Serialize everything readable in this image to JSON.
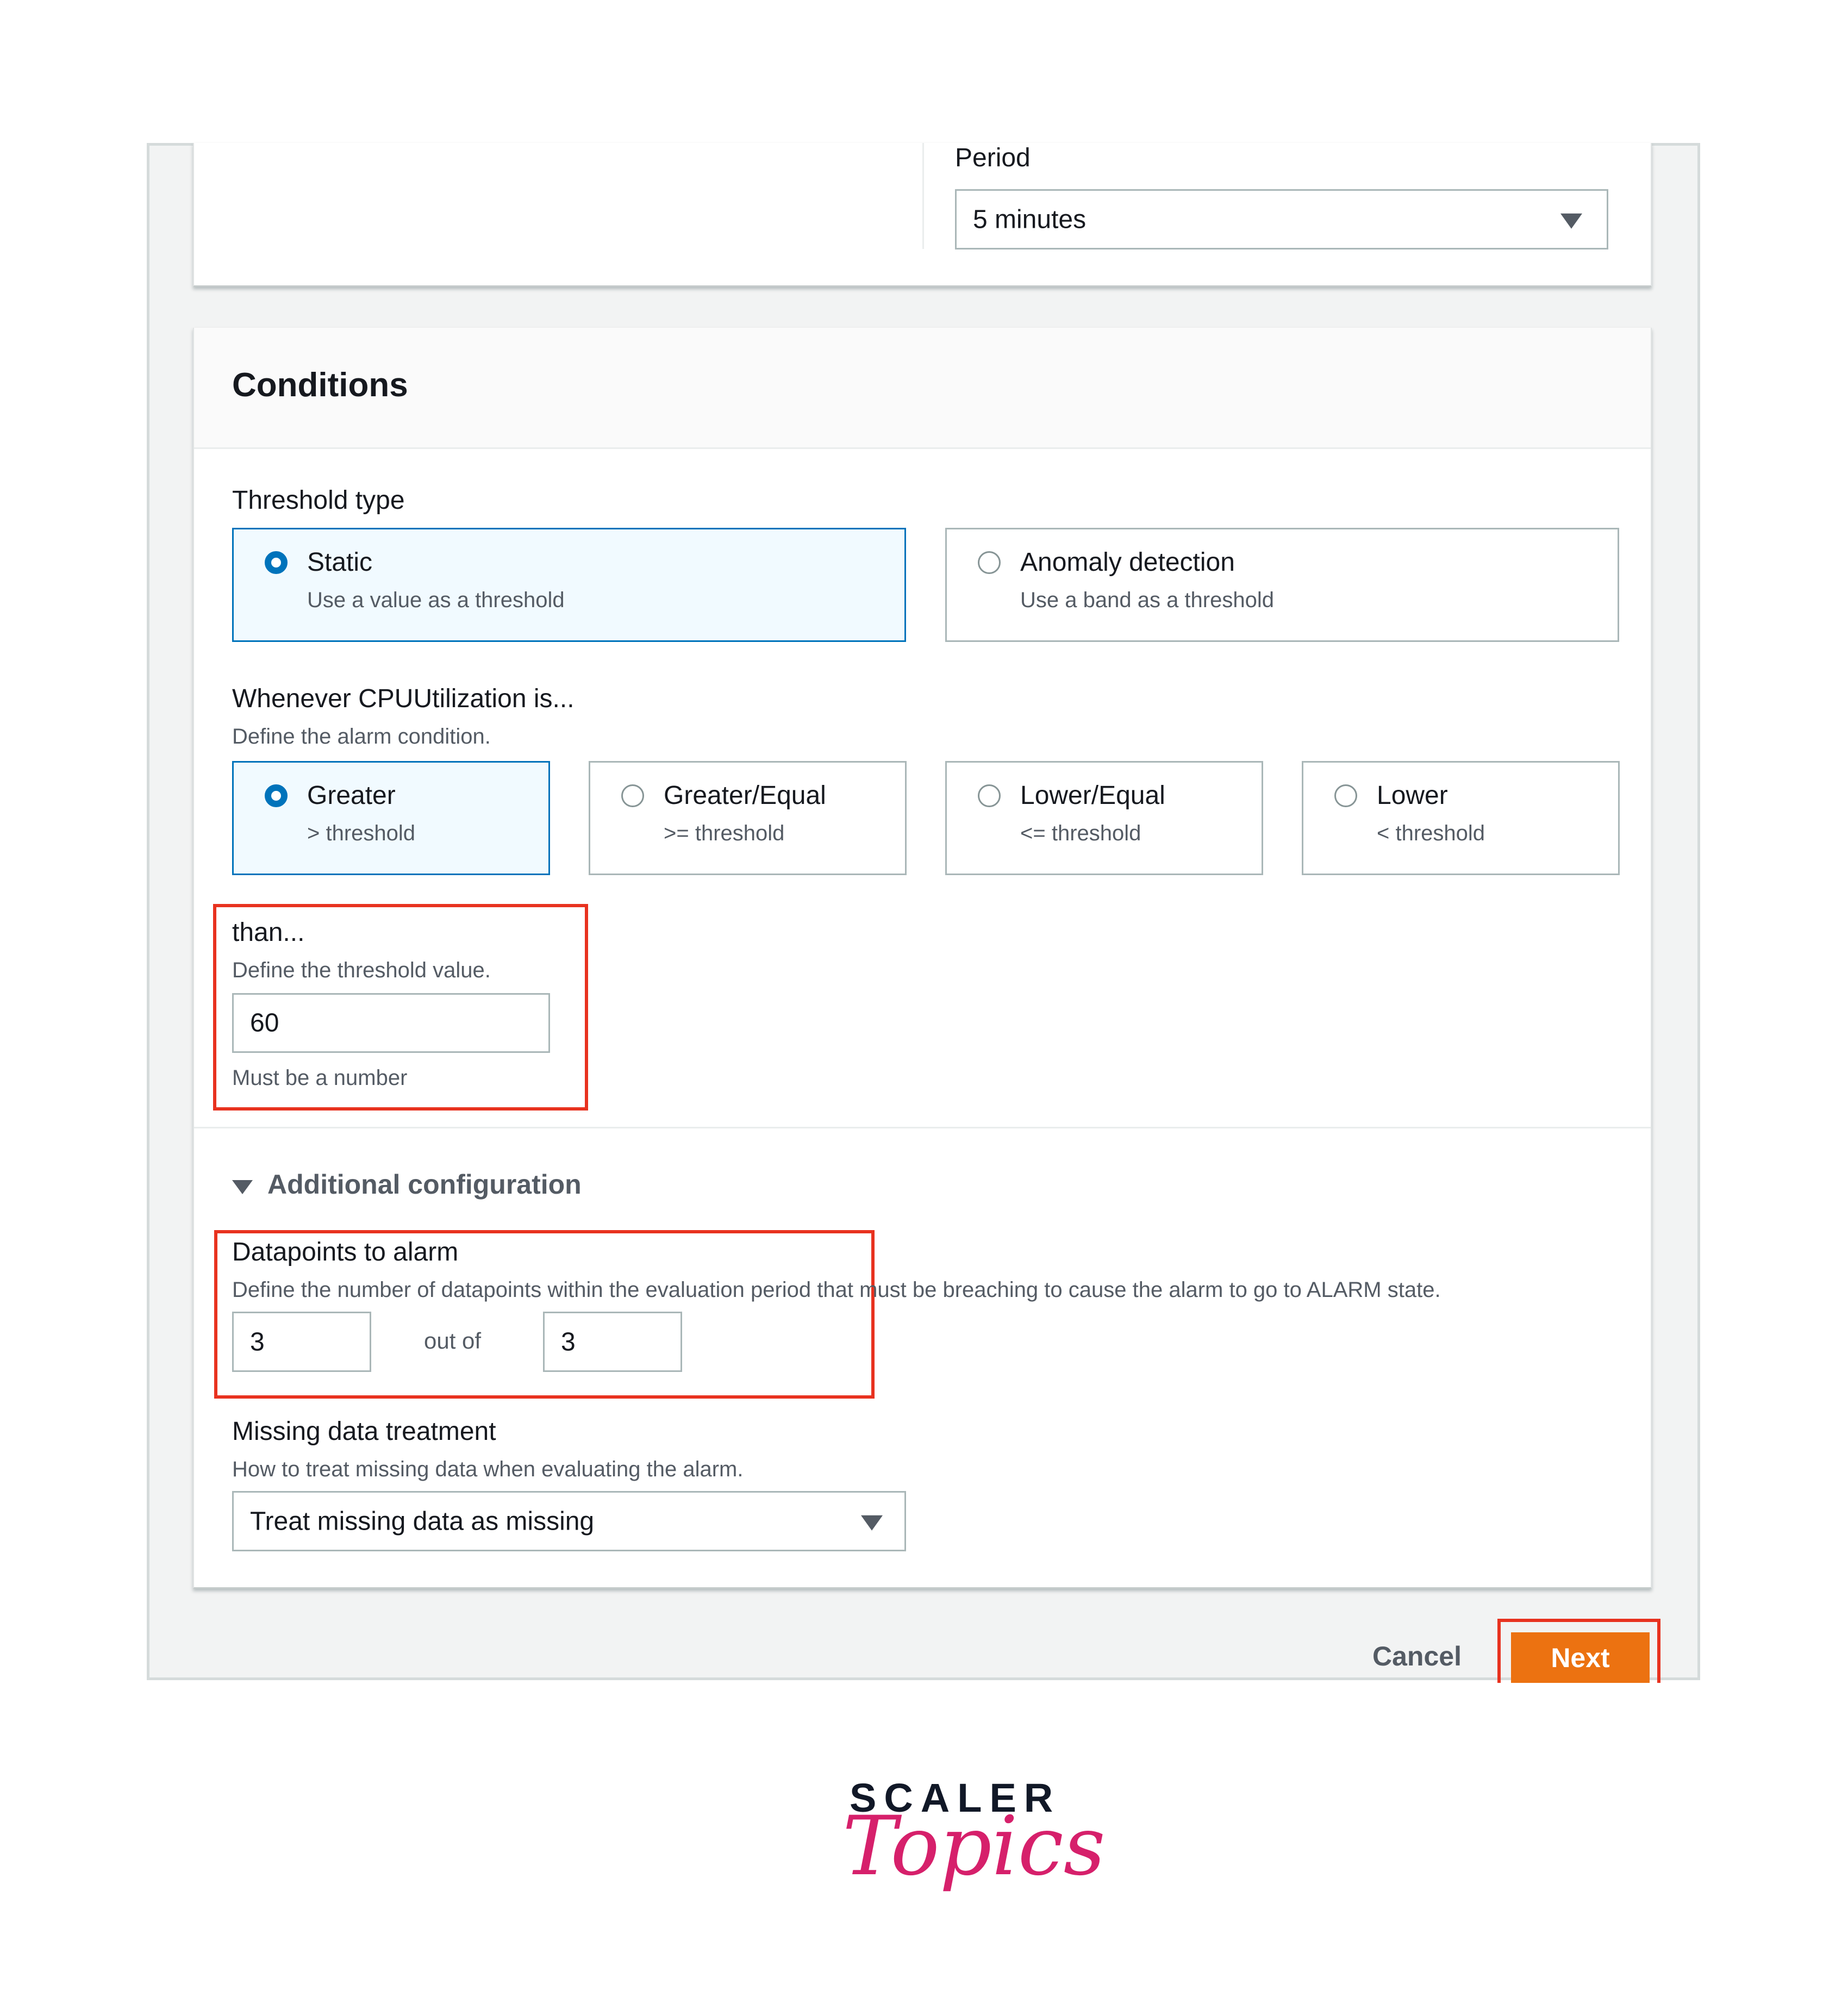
{
  "period": {
    "label": "Period",
    "value": "5 minutes"
  },
  "conditions": {
    "title": "Conditions",
    "threshold_type": {
      "label": "Threshold type",
      "options": [
        {
          "title": "Static",
          "subtitle": "Use a value as a threshold",
          "selected": true
        },
        {
          "title": "Anomaly detection",
          "subtitle": "Use a band as a threshold",
          "selected": false
        }
      ]
    },
    "whenever": {
      "label": "Whenever CPUUtilization is...",
      "description": "Define the alarm condition.",
      "options": [
        {
          "title": "Greater",
          "subtitle": "> threshold",
          "selected": true
        },
        {
          "title": "Greater/Equal",
          "subtitle": ">= threshold",
          "selected": false
        },
        {
          "title": "Lower/Equal",
          "subtitle": "<= threshold",
          "selected": false
        },
        {
          "title": "Lower",
          "subtitle": "< threshold",
          "selected": false
        }
      ]
    },
    "than": {
      "label": "than...",
      "description": "Define the threshold value.",
      "value": "60",
      "hint": "Must be a number"
    },
    "additional": {
      "label": "Additional configuration",
      "datapoints": {
        "label": "Datapoints to alarm",
        "description": "Define the number of datapoints within the evaluation period that must be breaching to cause the alarm to go to ALARM state.",
        "value_a": "3",
        "separator": "out of",
        "value_b": "3"
      },
      "missing": {
        "label": "Missing data treatment",
        "description": "How to treat missing data when evaluating the alarm.",
        "value": "Treat missing data as missing"
      }
    }
  },
  "footer": {
    "cancel": "Cancel",
    "next": "Next"
  },
  "logo": {
    "top": "SCALER",
    "script": "Topics"
  },
  "colors": {
    "accent": "#0073bb",
    "primary_button": "#ec7211",
    "highlight": "#e8321f",
    "logo_pink": "#d6206b"
  },
  "icons": {
    "select_caret": "caret-down-icon",
    "expand": "caret-down-icon"
  }
}
